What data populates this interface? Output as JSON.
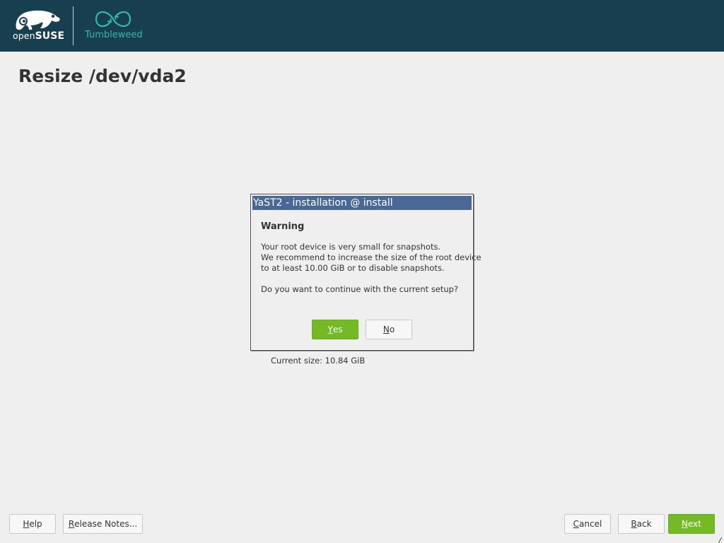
{
  "header": {
    "brand_prefix": "open",
    "brand_suffix": "SUSE",
    "distribution": "Tumbleweed",
    "logo_icon": "opensuse-chameleon-icon",
    "distribution_icon": "tumbleweed-infinity-icon",
    "background_color": "#173f4f",
    "accent_color": "#35b9ab"
  },
  "page": {
    "title": "Resize /dev/vda2",
    "current_size": "Current size: 10.84 GiB"
  },
  "dialog": {
    "window_title": "YaST2 - installation @ install",
    "heading": "Warning",
    "message_lines": [
      "Your root device is very small for snapshots.",
      "We recommend to increase the size of the root device",
      "to at least 10.00 GiB or to disable snapshots."
    ],
    "question": "Do you want to continue with the current setup?",
    "yes": {
      "accel": "Y",
      "rest": "es"
    },
    "no": {
      "accel": "N",
      "rest": "o"
    },
    "titlebar_color": "#4a6896"
  },
  "footer": {
    "help": {
      "accel": "H",
      "rest": "elp"
    },
    "release_notes": {
      "accel": "R",
      "rest": "elease Notes..."
    },
    "cancel": {
      "accel": "C",
      "rest": "ancel"
    },
    "back": {
      "accel": "B",
      "rest": "ack"
    },
    "next": {
      "accel": "N",
      "rest": "ext"
    },
    "primary_color": "#73ba25"
  }
}
